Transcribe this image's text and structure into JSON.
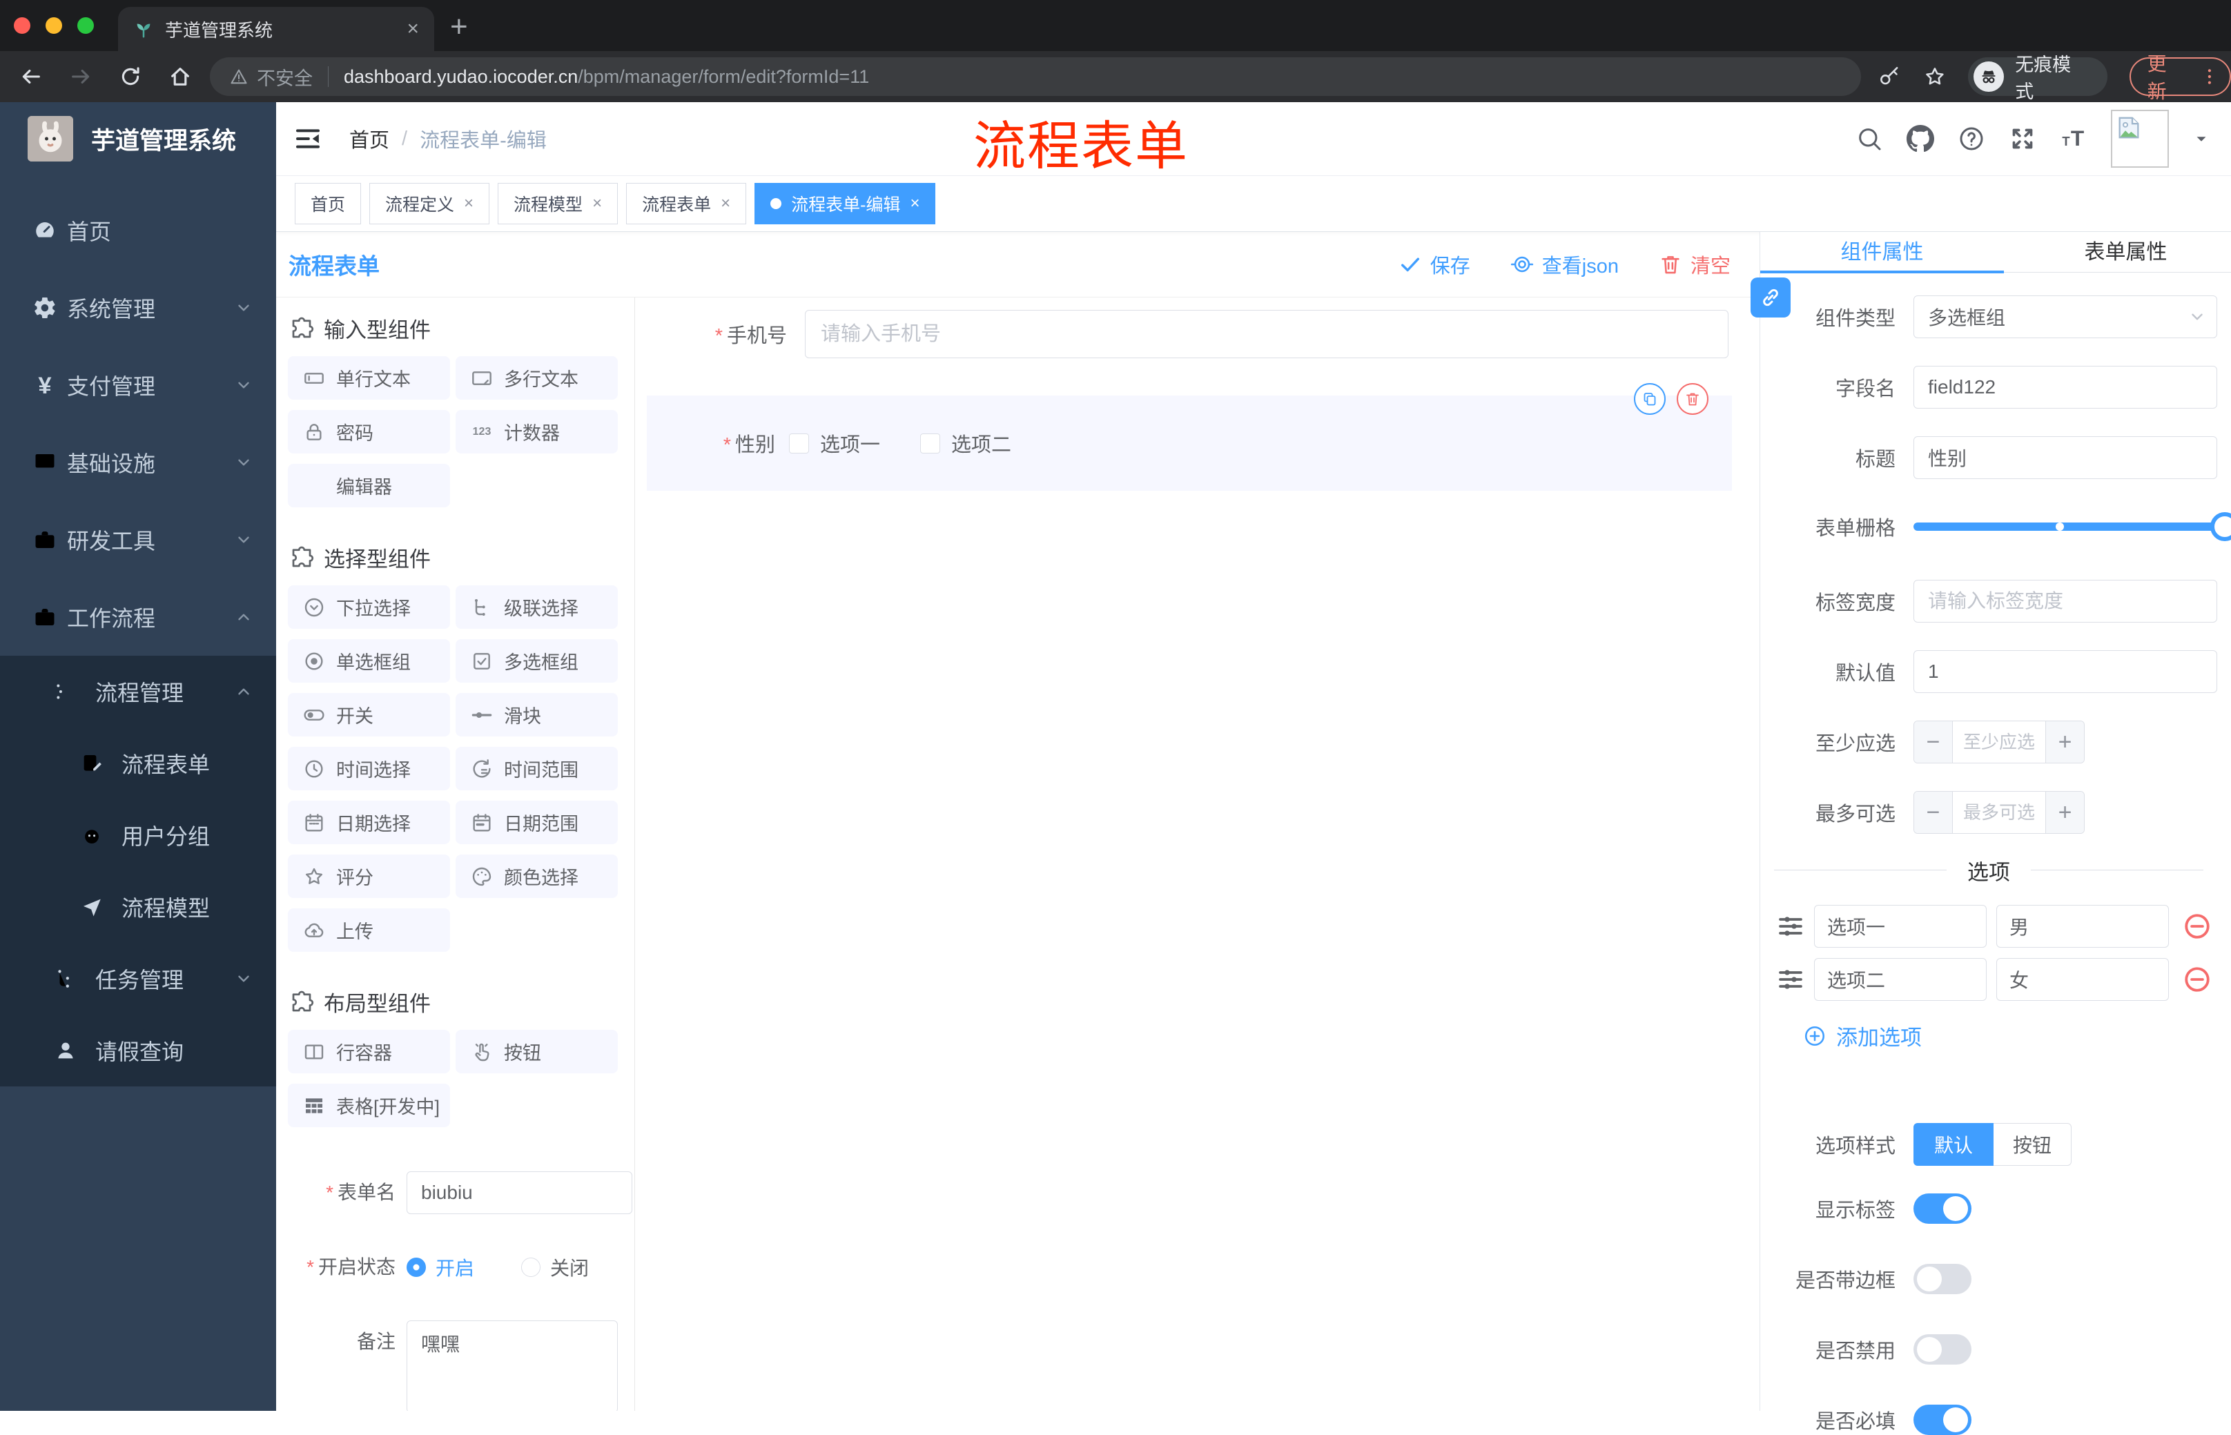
{
  "browser": {
    "tab_title": "芋道管理系统",
    "new_tab": "+",
    "security_label": "不安全",
    "url_host": "dashboard.yudao.iocoder.cn",
    "url_path": "/bpm/manager/form/edit?formId=11",
    "incognito_label": "无痕模式",
    "update_label": "更新"
  },
  "sidebar": {
    "app_title": "芋道管理系统",
    "home": "首页",
    "system": "系统管理",
    "payment": "支付管理",
    "infra": "基础设施",
    "devtools": "研发工具",
    "workflow": "工作流程",
    "process_mgmt": "流程管理",
    "process_form": "流程表单",
    "user_group": "用户分组",
    "process_model": "流程模型",
    "task_mgmt": "任务管理",
    "leave_query": "请假查询"
  },
  "header": {
    "breadcrumb_home": "首页",
    "breadcrumb_sep": "/",
    "breadcrumb_current": "流程表单-编辑",
    "annotation": "流程表单"
  },
  "tags": [
    {
      "label": "首页"
    },
    {
      "label": "流程定义"
    },
    {
      "label": "流程模型"
    },
    {
      "label": "流程表单"
    },
    {
      "label": "流程表单-编辑"
    }
  ],
  "designer": {
    "title": "流程表单",
    "save": "保存",
    "view_json": "查看json",
    "clear": "清空",
    "groups": [
      {
        "title": "输入型组件",
        "items": [
          {
            "label": "单行文本"
          },
          {
            "label": "多行文本"
          },
          {
            "label": "密码"
          },
          {
            "label": "计数器"
          },
          {
            "label": "编辑器"
          }
        ]
      },
      {
        "title": "选择型组件",
        "items": [
          {
            "label": "下拉选择"
          },
          {
            "label": "级联选择"
          },
          {
            "label": "单选框组"
          },
          {
            "label": "多选框组"
          },
          {
            "label": "开关"
          },
          {
            "label": "滑块"
          },
          {
            "label": "时间选择"
          },
          {
            "label": "时间范围"
          },
          {
            "label": "日期选择"
          },
          {
            "label": "日期范围"
          },
          {
            "label": "评分"
          },
          {
            "label": "颜色选择"
          },
          {
            "label": "上传"
          }
        ]
      },
      {
        "title": "布局型组件",
        "items": [
          {
            "label": "行容器"
          },
          {
            "label": "按钮"
          },
          {
            "label": "表格[开发中]"
          }
        ]
      }
    ],
    "meta": {
      "form_name_label": "表单名",
      "form_name_value": "biubiu",
      "status_label": "开启状态",
      "status_on": "开启",
      "status_off": "关闭",
      "remark_label": "备注",
      "remark_value": "嘿嘿"
    },
    "canvas": {
      "phone_label": "手机号",
      "phone_placeholder": "请输入手机号",
      "gender_label": "性别",
      "option1": "选项一",
      "option2": "选项二"
    }
  },
  "inspector": {
    "tab_component": "组件属性",
    "tab_form": "表单属性",
    "component_type_label": "组件类型",
    "component_type_value": "多选框组",
    "field_name_label": "字段名",
    "field_name_value": "field122",
    "title_label": "标题",
    "title_value": "性别",
    "grid_label": "表单栅格",
    "label_width_label": "标签宽度",
    "label_width_placeholder": "请输入标签宽度",
    "default_label": "默认值",
    "default_value": "1",
    "min_label": "至少应选",
    "min_placeholder": "至少应选",
    "max_label": "最多可选",
    "max_placeholder": "最多可选",
    "options_title": "选项",
    "options": [
      {
        "name": "选项一",
        "value": "男"
      },
      {
        "name": "选项二",
        "value": "女"
      }
    ],
    "add_option": "添加选项",
    "style_label": "选项样式",
    "style_default": "默认",
    "style_button": "按钮",
    "toggle_show_label": "显示标签",
    "toggle_border": "是否带边框",
    "toggle_disabled": "是否禁用",
    "toggle_required": "是否必填"
  },
  "colors": {
    "accent": "#409eff",
    "danger": "#f56c6c",
    "annotation_red": "#ff2b00",
    "sidebar_bg": "#304156",
    "submenu_bg": "#1f2d3d",
    "chip_bg": "#f6f7ff"
  }
}
